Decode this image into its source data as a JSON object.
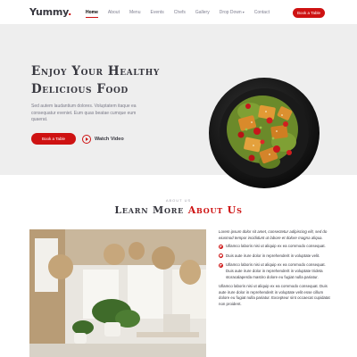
{
  "header": {
    "logo_text": "Yummy",
    "logo_dot": ".",
    "nav": [
      {
        "label": "Home",
        "active": true
      },
      {
        "label": "About"
      },
      {
        "label": "Menu"
      },
      {
        "label": "Events"
      },
      {
        "label": "Chefs"
      },
      {
        "label": "Gallery"
      },
      {
        "label": "Drop Down"
      },
      {
        "label": "Contact"
      }
    ],
    "book_label": "Book a Table"
  },
  "hero": {
    "title_line1": "Enjoy Your Healthy",
    "title_line2": "Delicious Food",
    "text": "Sed autem laudantium dolores. Voluptatem itaque ea consequatur eveniet. Eum quas beatae cumque eum quaerat.",
    "book_label": "Book a Table",
    "watch_label": "Watch Video"
  },
  "about": {
    "kicker": "ABOUT US",
    "title_main": "Learn More ",
    "title_accent": "About Us",
    "intro": "Lorem ipsum dolor sit amet, consectetur adipiscing elit, sed do eiusmod tempor incididunt ut labore et dolore magna aliqua.",
    "checks": [
      "Ullamco laboris nisi ut aliquip ex ea commodo consequat.",
      "Duis aute irure dolor in reprehenderit in voluptate velit.",
      "Ullamco laboris nisi ut aliquip ex ea commodo consequat. Duis aute irure dolor in reprehenderit in voluptate trideta storacalaperda mastiro dolore eu fugiat nulla pariatur."
    ],
    "outro": "Ullamco laboris nisi ut aliquip ex ea commodo consequat. Duis aute irure dolor in reprehenderit in voluptate velit esse cillum dolore eu fugiat nulla pariatur. Excepteur sint occaecat cupidatat non proident."
  },
  "colors": {
    "accent": "#ce1212",
    "hero_bg": "#eeeeee",
    "text_dark": "#37373f"
  }
}
